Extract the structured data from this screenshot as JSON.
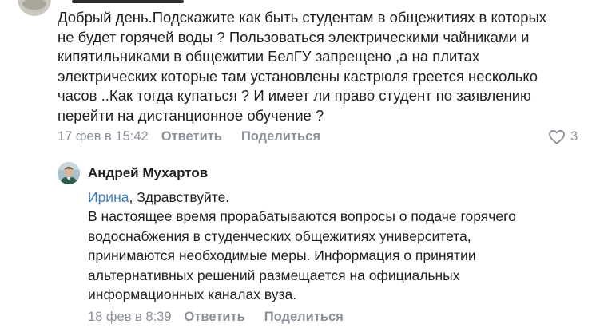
{
  "comment": {
    "text": "Добрый день.Подскажите как быть студентам в общежитиях в которых\nне будет горячей воды ? Пользоваться электрическими чайниками и\nкипятильниками в общежитии БелГУ запрещено ,а на плитах\nэлектрических которые там установлены кастрюля греется несколько\nчасов ..Как тогда купаться ? И имеет ли право студент по заявлению\nперейти на дистанционное обучение ?",
    "date": "17 фев в 15:42",
    "reply_label": "Ответить",
    "share_label": "Поделиться",
    "likes": "3",
    "like_icon": "heart-outline-icon"
  },
  "reply": {
    "author": "Андрей Мухартов",
    "mention": "Ирина",
    "greeting": ", Здравствуйте.",
    "text": "В настоящее время прорабатываются вопросы о подаче горячего\nводоснабжения в студенческих общежитиях университета,\nпринимаются необходимые меры. Информация о принятии\nальтернативных решений размещается на официальных\nинформационных каналах вуза.",
    "date": "18 фев в 8:39",
    "reply_label": "Ответить",
    "share_label": "Поделиться"
  },
  "colors": {
    "text": "#1f1f1f",
    "meta": "#8a9099",
    "mention": "#3f7bc0"
  }
}
